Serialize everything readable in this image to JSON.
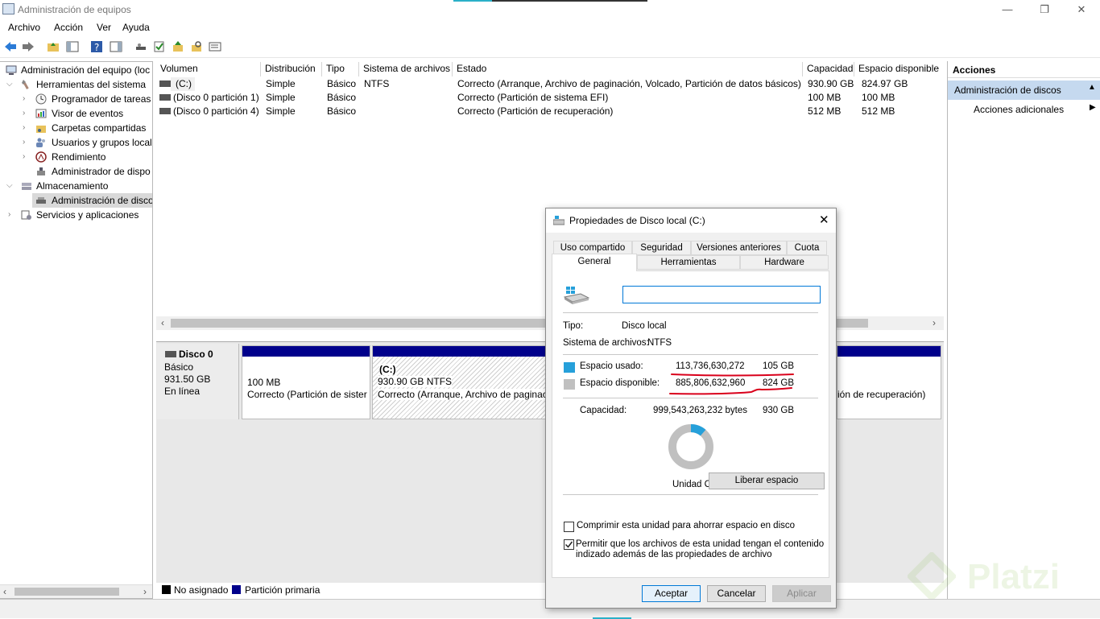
{
  "window": {
    "title": "Administración de equipos",
    "minimize": "—",
    "restore": "❐",
    "close": "✕"
  },
  "menu": [
    "Archivo",
    "Acción",
    "Ver",
    "Ayuda"
  ],
  "tree": {
    "root": "Administración del equipo (loc",
    "system_tools": "Herramientas del sistema",
    "task_scheduler": "Programador de tareas",
    "event_viewer": "Visor de eventos",
    "shared_folders": "Carpetas compartidas",
    "users_groups": "Usuarios y grupos locale",
    "performance": "Rendimiento",
    "device_manager": "Administrador de dispo",
    "storage": "Almacenamiento",
    "disk_management": "Administración de disco",
    "services": "Servicios y aplicaciones"
  },
  "volumes": {
    "headers": [
      "Volumen",
      "Distribución",
      "Tipo",
      "Sistema de archivos",
      "Estado",
      "Capacidad",
      "Espacio disponible"
    ],
    "rows": [
      [
        "(C:)",
        "Simple",
        "Básico",
        "NTFS",
        "Correcto (Arranque, Archivo de paginación, Volcado, Partición de datos básicos)",
        "930.90 GB",
        "824.97 GB"
      ],
      [
        "(Disco 0 partición 1)",
        "Simple",
        "Básico",
        "",
        "Correcto (Partición de sistema EFI)",
        "100 MB",
        "100 MB"
      ],
      [
        "(Disco 0 partición 4)",
        "Simple",
        "Básico",
        "",
        "Correcto (Partición de recuperación)",
        "512 MB",
        "512 MB"
      ]
    ]
  },
  "disk": {
    "name": "Disco 0",
    "type": "Básico",
    "size": "931.50 GB",
    "status": "En línea",
    "p1_size": "100 MB",
    "p1_status": "Correcto (Partición de sister",
    "p2_label": "(C:)",
    "p2_size": "930.90 GB NTFS",
    "p2_status": "Correcto (Arranque, Archivo de paginac",
    "p3_status": "ión de recuperación)"
  },
  "legend": {
    "unallocated": "No asignado",
    "primary": "Partición primaria"
  },
  "actions": {
    "header": "Acciones",
    "selected": "Administración de discos",
    "more": "Acciones adicionales"
  },
  "dialog": {
    "title": "Propiedades de Disco local (C:)",
    "tabs_top": [
      "Uso compartido",
      "Seguridad",
      "Versiones anteriores",
      "Cuota"
    ],
    "tabs_bottom": [
      "General",
      "Herramientas",
      "Hardware"
    ],
    "name_value": "",
    "type_label": "Tipo:",
    "type_value": "Disco local",
    "fs_label": "Sistema de archivos:",
    "fs_value": "NTFS",
    "used_label": "Espacio usado:",
    "used_bytes": "113,736,630,272",
    "used_gb": "105 GB",
    "free_label": "Espacio disponible:",
    "free_bytes": "885,806,632,960",
    "free_gb": "824 GB",
    "capacity_label": "Capacidad:",
    "capacity_bytes": "999,543,263,232 bytes",
    "capacity_gb": "930 GB",
    "drive_label": "Unidad C",
    "cleanup": "Liberar espacio",
    "compress": "Comprimir esta unidad para ahorrar espacio en disco",
    "index_line1": "Permitir que los archivos de esta unidad tengan el contenido",
    "index_line2": "indizado además de las propiedades de archivo",
    "ok": "Aceptar",
    "cancel": "Cancelar",
    "apply": "Aplicar",
    "used_fraction": 0.114
  },
  "colors": {
    "used": "#26a0da",
    "free": "#c0c0c0",
    "primary": "#00008b",
    "annotation": "#d9001b"
  },
  "watermark": "Platzi"
}
